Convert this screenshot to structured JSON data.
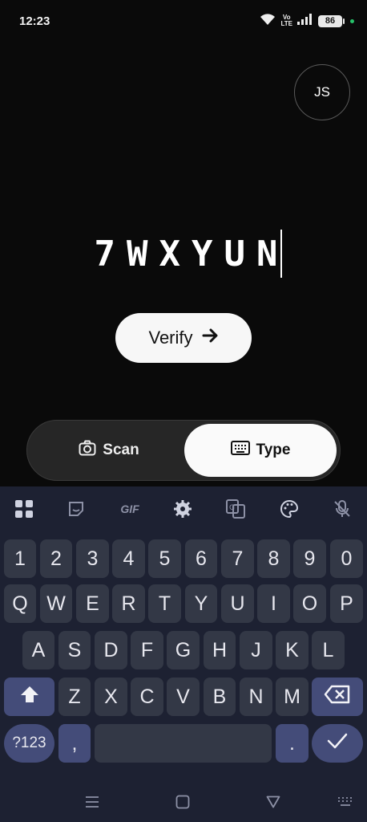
{
  "status_bar": {
    "time": "12:23",
    "volte_top": "Vo",
    "volte_bottom": "LTE",
    "battery": "86"
  },
  "avatar": {
    "initials": "JS"
  },
  "code": {
    "value": "7WXYUN"
  },
  "verify": {
    "label": "Verify"
  },
  "mode_toggle": {
    "scan_label": "Scan",
    "type_label": "Type",
    "selected": "Type"
  },
  "keyboard": {
    "toolbar": [
      "apps-icon",
      "sticker-icon",
      "gif-icon",
      "settings-icon",
      "translate-icon",
      "palette-icon",
      "mic-off-icon"
    ],
    "gif_label": "GIF",
    "row_numbers": [
      "1",
      "2",
      "3",
      "4",
      "5",
      "6",
      "7",
      "8",
      "9",
      "0"
    ],
    "row_top": [
      "Q",
      "W",
      "E",
      "R",
      "T",
      "Y",
      "U",
      "I",
      "O",
      "P"
    ],
    "row_middle": [
      "A",
      "S",
      "D",
      "F",
      "G",
      "H",
      "J",
      "K",
      "L"
    ],
    "row_bottom": [
      "Z",
      "X",
      "C",
      "V",
      "B",
      "N",
      "M"
    ],
    "symbols_label": "?123",
    "comma": ",",
    "period": "."
  },
  "colors": {
    "background": "#0a0a0a",
    "keyboard_bg": "#1d2132",
    "key_bg": "#333846",
    "function_key_bg": "#444c79"
  }
}
